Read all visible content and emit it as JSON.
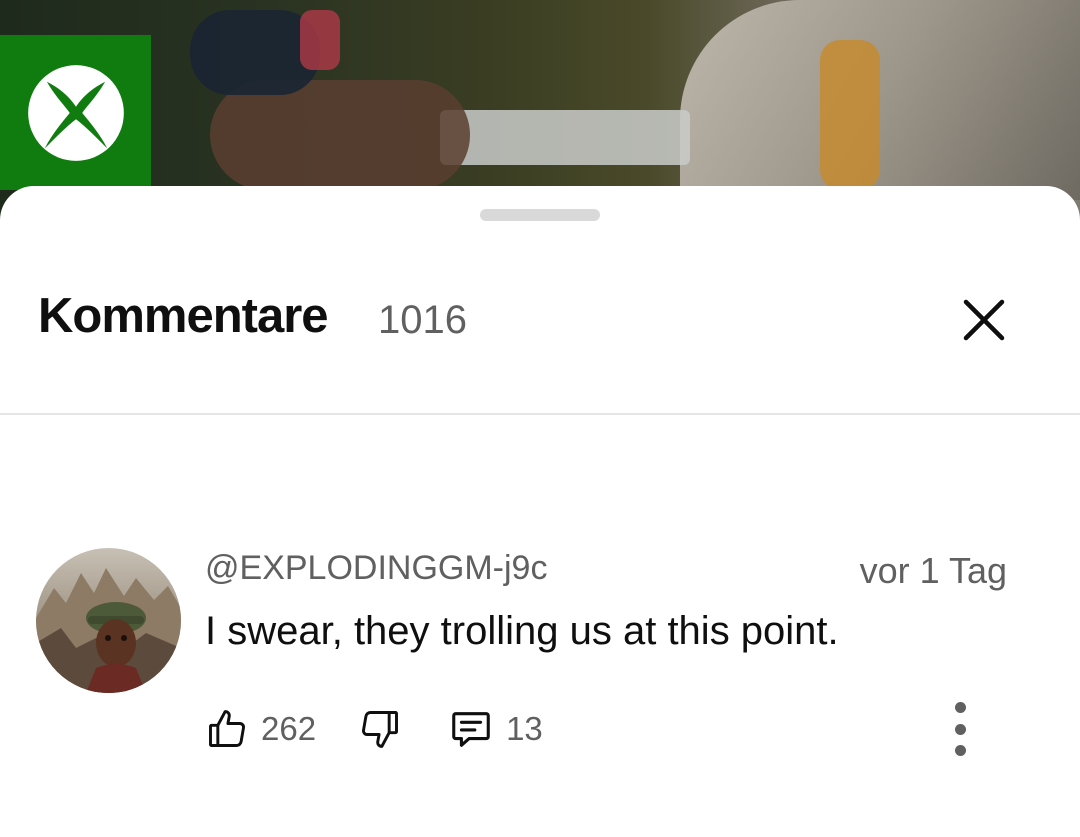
{
  "video": {
    "badge_icon": "xbox-logo-icon",
    "badge_color": "#107c10"
  },
  "comments_panel": {
    "title": "Kommentare",
    "count": "1016",
    "close_icon": "close-icon"
  },
  "comment": {
    "author": "@EXPLODINGGM-j9c",
    "timestamp": "vor 1 Tag",
    "text": "I swear, they trolling us at this point.",
    "likes": "262",
    "replies": "13",
    "icons": [
      "thumbs-up-icon",
      "thumbs-down-icon",
      "reply-icon",
      "more-vert-icon"
    ]
  },
  "colors": {
    "primary_text": "#0f0f0f",
    "secondary_text": "#606060",
    "divider": "#e5e5e5"
  }
}
